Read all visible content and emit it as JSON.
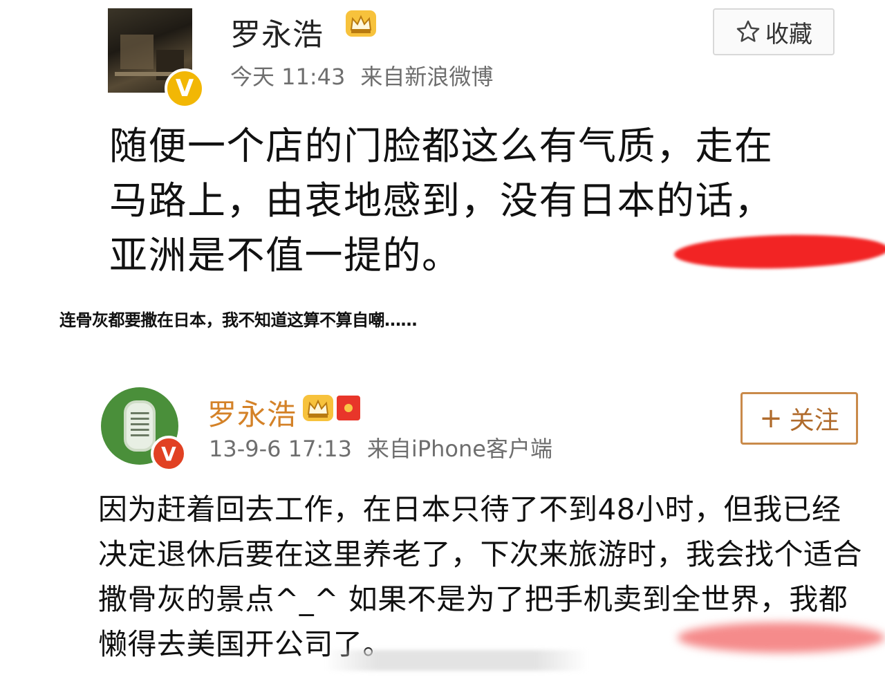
{
  "post1": {
    "author": "罗永浩",
    "time": "今天 11:43",
    "source": "来自新浪微博",
    "favorite_label": "收藏",
    "text": "随便一个店的门脸都这么有气质，走在\n马路上，由衷地感到，没有日本的话，\n亚洲是不值一提的。"
  },
  "caption": "连骨灰都要撒在日本，我不知道这算不算自嘲……",
  "post2": {
    "author": "罗永浩",
    "time": "13-9-6 17:13",
    "source": "来自iPhone客户端",
    "follow_label": "关注",
    "text": "因为赶着回去工作，在日本只待了不到48小时，但我已经决定退休后要在这里养老了，下次来旅游时，我会找个适合撒骨灰的景点^_^ 如果不是为了把手机卖到全世界，我都懒得去美国开公司了。"
  },
  "icons": {
    "verified_badge_1": "v-verified-gold",
    "verified_badge_2": "v-verified-red",
    "vip_badge": "crown-icon",
    "favorite": "star-outline-icon",
    "red_packet": "red-envelope-icon"
  },
  "colors": {
    "redaction": "#f22424",
    "name_vip": "#d48228",
    "follow": "#b06b2c",
    "verified_gold": "#f2b705",
    "verified_red": "#e14123"
  }
}
